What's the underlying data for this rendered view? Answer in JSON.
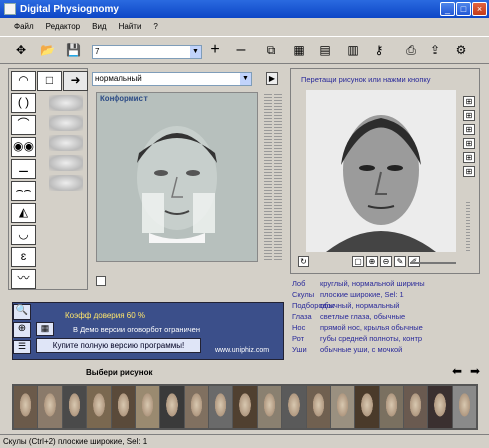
{
  "window": {
    "title": "Digital Physiognomy"
  },
  "menu": [
    "Файл",
    "Редактор",
    "Вид",
    "Найти",
    "?"
  ],
  "toolbar": {
    "preset_value": "7",
    "plus": "+",
    "minus": "–"
  },
  "left": {
    "mode_value": "нормальный"
  },
  "workspace": {
    "label": "Конформист"
  },
  "photo_panel": {
    "hint": "Перетащи рисунок или нажми кнопку"
  },
  "descriptions": [
    {
      "key": "Лоб",
      "value": "круглый, нормальной ширины"
    },
    {
      "key": "Скулы",
      "value": "плоские широкие, Sel: 1"
    },
    {
      "key": "Подбородок",
      "value": "обычный, нормальный"
    },
    {
      "key": "Глаза",
      "value": "светлые глаза, обычные"
    },
    {
      "key": "Нос",
      "value": "прямой нос, крылья обычные"
    },
    {
      "key": "Рот",
      "value": "губы средней полноты, контр"
    },
    {
      "key": "Уши",
      "value": "обычные уши, с мочкой"
    }
  ],
  "status_panel": {
    "coeff": "Коэфф доверия  60  %",
    "demo": "В Демо версии оговорбот ограничен",
    "buy": "Купите полную версию программы!",
    "site": "www.uniphiz.com"
  },
  "gallery": {
    "label": "Выбери рисунок",
    "count": 19
  },
  "statusbar": {
    "text": "Скулы (Ctrl+2) плоские широкие, Sel: 1"
  },
  "colors": {
    "title_bar": "#0d46c6",
    "panel_blue": "#3b4f8a",
    "label_blue": "#2a2a9a"
  }
}
